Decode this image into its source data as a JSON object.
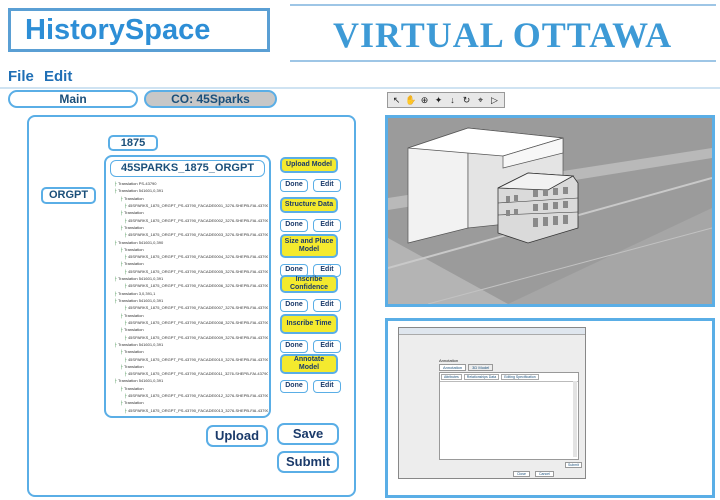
{
  "app_title": "HistorySpace",
  "brand_title": "VIRTUAL OTTAWA",
  "menu": {
    "file": "File",
    "edit": "Edit"
  },
  "tabs": {
    "main": "Main",
    "co": "CO: 45Sparks"
  },
  "left": {
    "year": "1875",
    "category": "ORGPT",
    "model_title": "45SPARKS_1875_ORGPT",
    "tree": [
      "Translation PS-43790",
      "Translation 541601,0,391",
      "Translation",
      "45SPARKS_1875_ORGPT_PS-43790_FACADE0001_3276-SHEPB-FAI-43790.SKI",
      "Translation",
      "45SPARKS_1875_ORGPT_PS-43790_FACADE0002_3276-SHEPB-FAI-43790.SKI",
      "Translation",
      "45SPARKS_1875_ORGPT_PS-43790_FACADE0003_3276-SHEPB-FAI-43790.SKI",
      "Translation 541601,0,390",
      "Translation",
      "45SPARKS_1875_ORGPT_PS-43790_FACADE0004_3276-SHEPB-FAI-43790.SKI",
      "Translation",
      "45SPARKS_1875_ORGPT_PS-43790_FACADE0005_3276-SHEPB-FAI-43790.SKI",
      "Translation 541601,0,391",
      "45SPARKS_1875_ORGPT_PS-43790_FACADE0006_3276-SHEPB-FAI-43790.SKI",
      "Translation 3,0,391,1",
      "Translation 541601,0,391",
      "45SPARKS_1875_ORGPT_PS-43790_FACADE0007_3276-SHEPB-FAI-43790.SKI",
      "Translation",
      "45SPARKS_1875_ORGPT_PS-43790_FACADE0008_3276-SHEPB-FAI-43790.SKI",
      "Translation",
      "45SPARKS_1875_ORGPT_PS-43790_FACADE0009_3276-SHEPB-FAI-43790.SKI",
      "Translation 541601,0,391",
      "Translation",
      "45SPARKS_1875_ORGPT_PS-43790_FACADE0010_3276-SHEPB-FAI-43790.SKI",
      "Translation",
      "45SPARKS_1875_ORGPT_PS-43790_FACADE0011_3276-SHEPB-FAI-43790.SKI",
      "Translation 541601,0,391",
      "Translation",
      "45SPARKS_1875_ORGPT_PS-43790_FACADE0012_3276-SHEPB-FAI-43790.SKI",
      "Translation",
      "45SPARKS_1875_ORGPT_PS-43790_FACADE0013_3276-SHEPB-FAI-43790.SKI"
    ],
    "actions": [
      "Upload Model",
      "Structure Data",
      "Size and Place Model",
      "Inscribe Confidence",
      "Inscribe Time",
      "Annotate Model"
    ],
    "done": "Done",
    "edit": "Edit",
    "upload": "Upload",
    "save": "Save",
    "submit": "Submit"
  },
  "dialog": {
    "title": "Annotation",
    "tabs": [
      "Annotation",
      "3D Model"
    ],
    "subtabs": [
      "Attributes",
      "Relationships Data",
      "Editing Specification"
    ],
    "ok": "Close",
    "cancel": "Cancel",
    "apply": "Submit"
  },
  "colors": {
    "accent": "#5aaee6",
    "action_yellow": "#f4ea2e",
    "brand_blue": "#3d9ad6"
  },
  "toolbar_icons": [
    "select-arrow-icon",
    "hand-icon",
    "orbit-icon",
    "pan-icon",
    "walk-icon",
    "rotate-icon",
    "zoom-icon",
    "play-icon"
  ]
}
